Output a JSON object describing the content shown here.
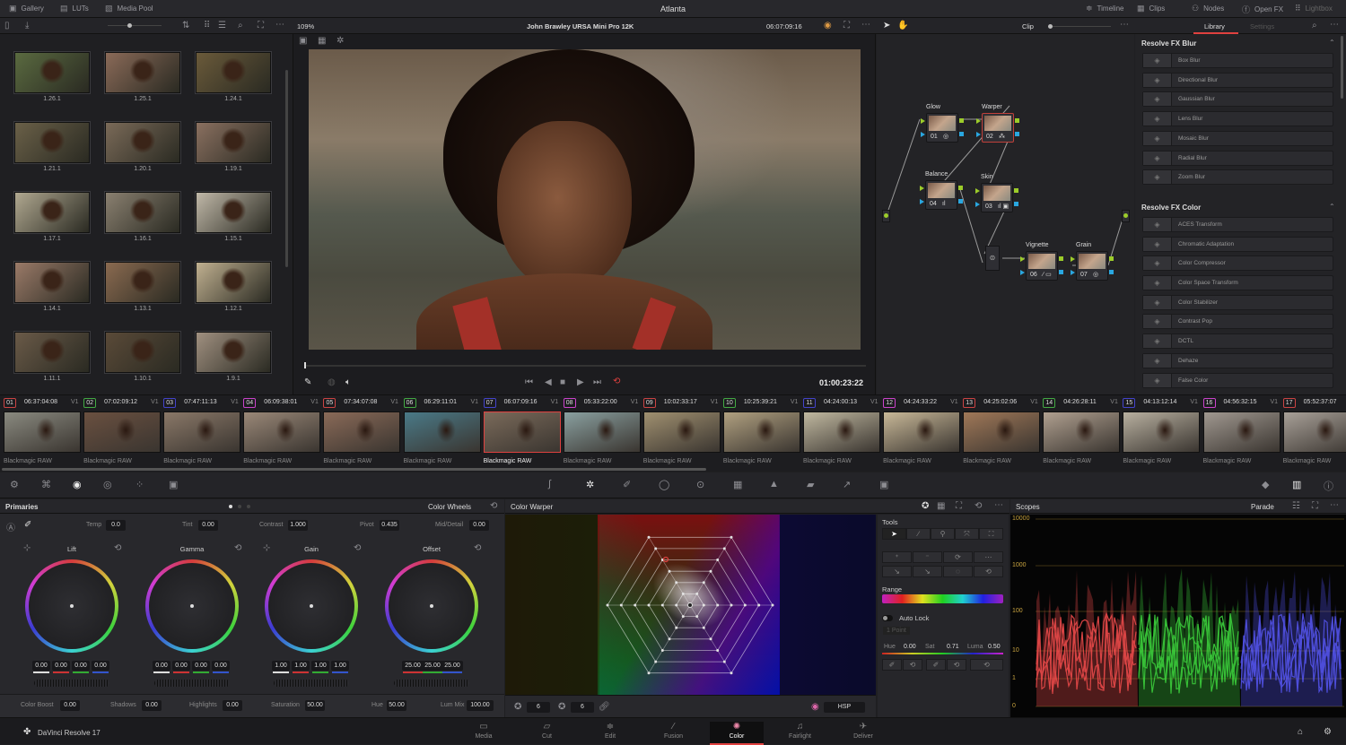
{
  "topbar": {
    "title": "Atlanta",
    "left_tabs": [
      {
        "label": "Gallery",
        "icon": "gallery-icon"
      },
      {
        "label": "LUTs",
        "icon": "luts-icon"
      },
      {
        "label": "Media Pool",
        "icon": "media-pool-icon"
      }
    ],
    "right_tabs": [
      {
        "label": "Timeline",
        "icon": "timeline-icon"
      },
      {
        "label": "Clips",
        "icon": "clips-icon"
      },
      {
        "label": "Nodes",
        "icon": "nodes-icon"
      },
      {
        "label": "Open FX",
        "icon": "fx-icon"
      },
      {
        "label": "Lightbox",
        "icon": "lightbox-icon"
      }
    ]
  },
  "viewer": {
    "zoom": "109%",
    "clip_name": "John Brawley URSA Mini Pro 12K",
    "source_timecode": "06:07:09:16",
    "record_timecode": "01:00:23:22"
  },
  "nodes_toolbar": {
    "mode": "Clip"
  },
  "library": {
    "tabs": [
      "Library",
      "Settings"
    ],
    "active_tab": "Library",
    "sections": [
      {
        "title": "Resolve FX Blur",
        "items": [
          "Box Blur",
          "Directional Blur",
          "Gaussian Blur",
          "Lens Blur",
          "Mosaic Blur",
          "Radial Blur",
          "Zoom Blur"
        ]
      },
      {
        "title": "Resolve FX Color",
        "items": [
          "ACES Transform",
          "Chromatic Adaptation",
          "Color Compressor",
          "Color Space Transform",
          "Color Stabilizer",
          "Contrast Pop",
          "DCTL",
          "Dehaze",
          "False Color"
        ]
      }
    ]
  },
  "gallery": {
    "stills": [
      "1.26.1",
      "1.25.1",
      "1.24.1",
      "1.21.1",
      "1.20.1",
      "1.19.1",
      "1.17.1",
      "1.16.1",
      "1.15.1",
      "1.14.1",
      "1.13.1",
      "1.12.1",
      "1.11.1",
      "1.10.1",
      "1.9.1"
    ]
  },
  "nodes": [
    {
      "label": "Glow",
      "num": "01"
    },
    {
      "label": "Warper",
      "num": "02"
    },
    {
      "label": "Balance",
      "num": "04"
    },
    {
      "label": "Skin",
      "num": "03"
    },
    {
      "label": "Vignette",
      "num": "06"
    },
    {
      "label": "Grain",
      "num": "07"
    }
  ],
  "clips": {
    "track": "V1",
    "codec": "Blackmagic RAW",
    "selected": "07",
    "items": [
      {
        "num": "01",
        "tc": "06:37:04:08"
      },
      {
        "num": "02",
        "tc": "07:02:09:12"
      },
      {
        "num": "03",
        "tc": "07:47:11:13"
      },
      {
        "num": "04",
        "tc": "06:09:38:01"
      },
      {
        "num": "05",
        "tc": "07:34:07:08"
      },
      {
        "num": "06",
        "tc": "06:29:11:01"
      },
      {
        "num": "07",
        "tc": "06:07:09:16"
      },
      {
        "num": "08",
        "tc": "05:33:22:00"
      },
      {
        "num": "09",
        "tc": "10:02:33:17"
      },
      {
        "num": "10",
        "tc": "10:25:39:21"
      },
      {
        "num": "11",
        "tc": "04:24:00:13"
      },
      {
        "num": "12",
        "tc": "04:24:33:22"
      },
      {
        "num": "13",
        "tc": "04:25:02:06"
      },
      {
        "num": "14",
        "tc": "04:26:28:11"
      },
      {
        "num": "15",
        "tc": "04:13:12:14"
      },
      {
        "num": "16",
        "tc": "04:56:32:15"
      },
      {
        "num": "17",
        "tc": "05:52:37:07"
      }
    ]
  },
  "primaries": {
    "title": "Primaries",
    "mode": "Color Wheels",
    "top_params": [
      {
        "label": "Temp",
        "value": "0.0"
      },
      {
        "label": "Tint",
        "value": "0.00"
      },
      {
        "label": "Contrast",
        "value": "1.000"
      },
      {
        "label": "Pivot",
        "value": "0.435"
      },
      {
        "label": "Mid/Detail",
        "value": "0.00"
      }
    ],
    "wheels": [
      {
        "name": "Lift",
        "values": [
          "0.00",
          "0.00",
          "0.00",
          "0.00"
        ]
      },
      {
        "name": "Gamma",
        "values": [
          "0.00",
          "0.00",
          "0.00",
          "0.00"
        ]
      },
      {
        "name": "Gain",
        "values": [
          "1.00",
          "1.00",
          "1.00",
          "1.00"
        ]
      },
      {
        "name": "Offset",
        "values": [
          "25.00",
          "25.00",
          "25.00"
        ]
      }
    ],
    "bottom_params": [
      {
        "label": "Color Boost",
        "value": "0.00"
      },
      {
        "label": "Shadows",
        "value": "0.00"
      },
      {
        "label": "Highlights",
        "value": "0.00"
      },
      {
        "label": "Saturation",
        "value": "50.00"
      },
      {
        "label": "Hue",
        "value": "50.00"
      },
      {
        "label": "Lum Mix",
        "value": "100.00"
      }
    ]
  },
  "warper": {
    "title": "Color Warper",
    "grid_a": "6",
    "grid_b": "6",
    "color_space": "HSP",
    "tools_label": "Tools",
    "range_label": "Range",
    "auto_lock": "Auto Lock",
    "point_mode": "1 Point",
    "hue_label": "Hue",
    "hue": "0.00",
    "sat_label": "Sat",
    "sat": "0.71",
    "luma_label": "Luma",
    "luma": "0.50"
  },
  "scopes": {
    "title": "Scopes",
    "mode": "Parade",
    "scale": [
      "10000",
      "1000",
      "100",
      "10",
      "1",
      "0"
    ]
  },
  "footer": {
    "app": "DaVinci Resolve 17",
    "pages": [
      "Media",
      "Cut",
      "Edit",
      "Fusion",
      "Color",
      "Fairlight",
      "Deliver"
    ],
    "active_page": "Color"
  },
  "colors": {
    "accent": "#e0413f",
    "bg": "#1f1f22",
    "node_green": "#9ccc2a",
    "node_blue": "#2aa7e0"
  }
}
